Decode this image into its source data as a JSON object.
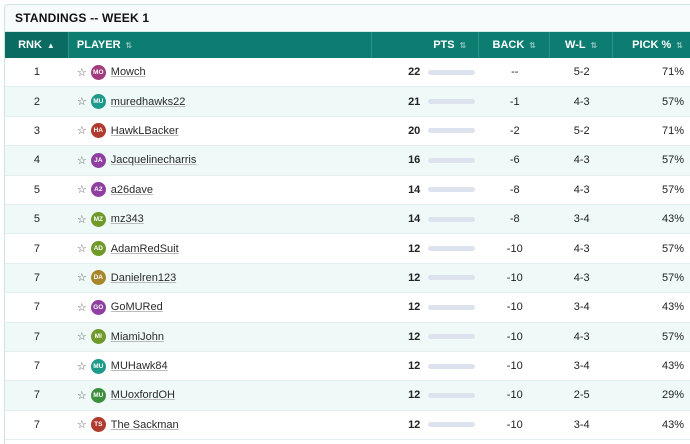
{
  "title": "STANDINGS -- WEEK 1",
  "columns": {
    "rnk": "RNK",
    "rnk_sort": "▲",
    "player": "PLAYER",
    "pts": "PTS",
    "back": "BACK",
    "wl": "W-L",
    "pick": "PICK %"
  },
  "rows": [
    {
      "rank": "1",
      "initials": "MO",
      "color": "#a23b7d",
      "name": "Mowch",
      "pts": "22",
      "back": "--",
      "wl": "5-2",
      "pick": "71%"
    },
    {
      "rank": "2",
      "initials": "MU",
      "color": "#1f9a8a",
      "name": "muredhawks22",
      "pts": "21",
      "back": "-1",
      "wl": "4-3",
      "pick": "57%"
    },
    {
      "rank": "3",
      "initials": "HA",
      "color": "#b03a2e",
      "name": "HawkLBacker",
      "pts": "20",
      "back": "-2",
      "wl": "5-2",
      "pick": "71%"
    },
    {
      "rank": "4",
      "initials": "JA",
      "color": "#8e3fa0",
      "name": "Jacquelinecharris",
      "pts": "16",
      "back": "-6",
      "wl": "4-3",
      "pick": "57%"
    },
    {
      "rank": "5",
      "initials": "A2",
      "color": "#8e3fa0",
      "name": "a26dave",
      "pts": "14",
      "back": "-8",
      "wl": "4-3",
      "pick": "57%"
    },
    {
      "rank": "5",
      "initials": "MZ",
      "color": "#6f9a2a",
      "name": "mz343",
      "pts": "14",
      "back": "-8",
      "wl": "3-4",
      "pick": "43%"
    },
    {
      "rank": "7",
      "initials": "AD",
      "color": "#6f9a2a",
      "name": "AdamRedSuit",
      "pts": "12",
      "back": "-10",
      "wl": "4-3",
      "pick": "57%"
    },
    {
      "rank": "7",
      "initials": "DA",
      "color": "#a8862a",
      "name": "Danielren123",
      "pts": "12",
      "back": "-10",
      "wl": "4-3",
      "pick": "57%"
    },
    {
      "rank": "7",
      "initials": "GO",
      "color": "#8e3fa0",
      "name": "GoMURed",
      "pts": "12",
      "back": "-10",
      "wl": "3-4",
      "pick": "43%"
    },
    {
      "rank": "7",
      "initials": "MI",
      "color": "#6f9a2a",
      "name": "MiamiJohn",
      "pts": "12",
      "back": "-10",
      "wl": "4-3",
      "pick": "57%"
    },
    {
      "rank": "7",
      "initials": "MU",
      "color": "#1f9a8a",
      "name": "MUHawk84",
      "pts": "12",
      "back": "-10",
      "wl": "3-4",
      "pick": "43%"
    },
    {
      "rank": "7",
      "initials": "MU",
      "color": "#3c8f3c",
      "name": "MUoxfordOH",
      "pts": "12",
      "back": "-10",
      "wl": "2-5",
      "pick": "29%"
    },
    {
      "rank": "7",
      "initials": "TS",
      "color": "#b03a2e",
      "name": "The Sackman",
      "pts": "12",
      "back": "-10",
      "wl": "3-4",
      "pick": "43%"
    }
  ]
}
